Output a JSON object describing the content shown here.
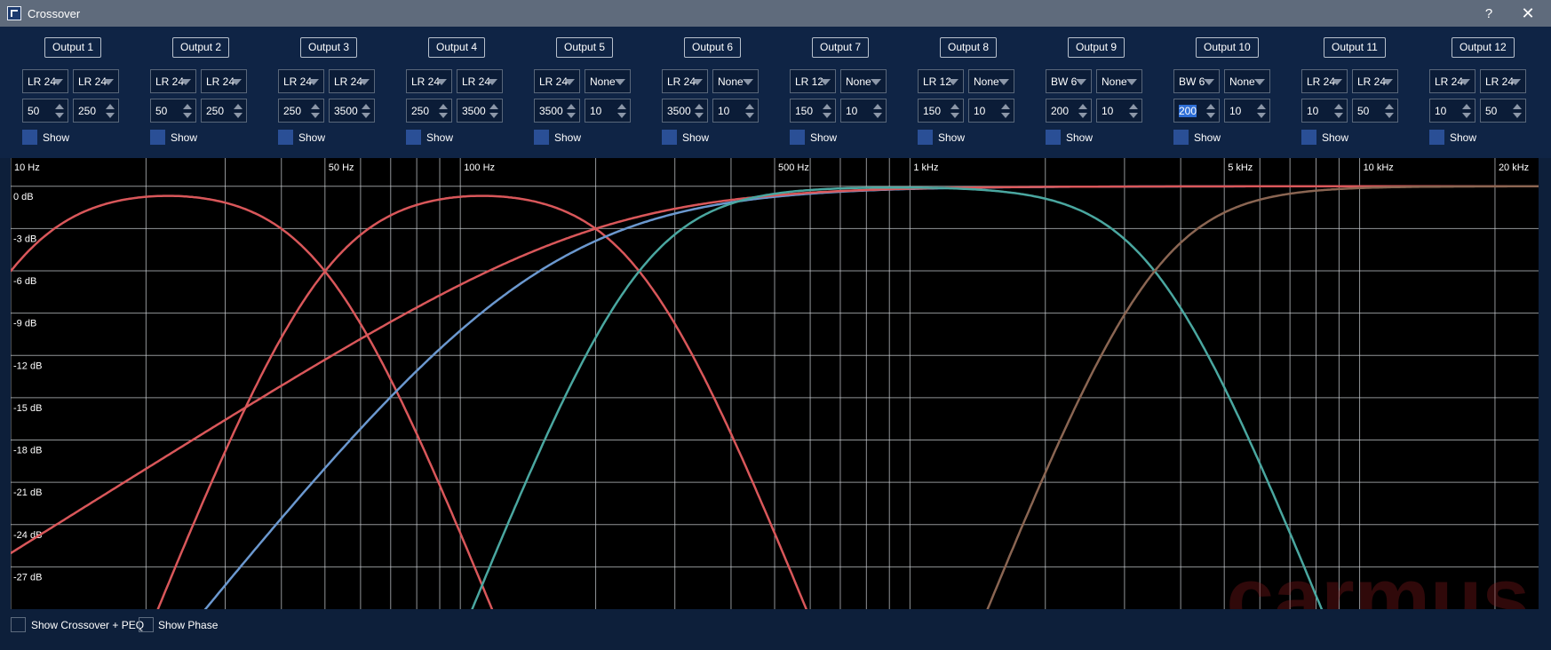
{
  "window": {
    "title": "Crossover",
    "help_label": "?",
    "close_label": "✕"
  },
  "colors": {
    "title_bar": "#5f6b7c",
    "panel": "#0f2445",
    "plot_bg": "#000000",
    "grid": "#cfd3d8",
    "curve_red": "#d9575a",
    "curve_blue": "#6b98cf",
    "curve_teal": "#4aa7a0",
    "curve_brown": "#8a6552",
    "checkbox": "#2a4f96"
  },
  "outputs": [
    {
      "label": "Output 1",
      "type_hp": "LR 24",
      "type_lp": "LR 24",
      "freq_hp": "50",
      "freq_lp": "250",
      "show": "Show"
    },
    {
      "label": "Output 2",
      "type_hp": "LR 24",
      "type_lp": "LR 24",
      "freq_hp": "50",
      "freq_lp": "250",
      "show": "Show"
    },
    {
      "label": "Output 3",
      "type_hp": "LR 24",
      "type_lp": "LR 24",
      "freq_hp": "250",
      "freq_lp": "3500",
      "show": "Show"
    },
    {
      "label": "Output 4",
      "type_hp": "LR 24",
      "type_lp": "LR 24",
      "freq_hp": "250",
      "freq_lp": "3500",
      "show": "Show"
    },
    {
      "label": "Output 5",
      "type_hp": "LR 24",
      "type_lp": "None",
      "freq_hp": "3500",
      "freq_lp": "10",
      "show": "Show"
    },
    {
      "label": "Output 6",
      "type_hp": "LR 24",
      "type_lp": "None",
      "freq_hp": "3500",
      "freq_lp": "10",
      "show": "Show"
    },
    {
      "label": "Output 7",
      "type_hp": "LR 12",
      "type_lp": "None",
      "freq_hp": "150",
      "freq_lp": "10",
      "show": "Show"
    },
    {
      "label": "Output 8",
      "type_hp": "LR 12",
      "type_lp": "None",
      "freq_hp": "150",
      "freq_lp": "10",
      "show": "Show"
    },
    {
      "label": "Output 9",
      "type_hp": "BW 6",
      "type_lp": "None",
      "freq_hp": "200",
      "freq_lp": "10",
      "show": "Show"
    },
    {
      "label": "Output 10",
      "type_hp": "BW 6",
      "type_lp": "None",
      "freq_hp": "200",
      "freq_lp": "10",
      "show": "Show",
      "selected_field": "freq_hp"
    },
    {
      "label": "Output 11",
      "type_hp": "LR 24",
      "type_lp": "LR 24",
      "freq_hp": "10",
      "freq_lp": "50",
      "show": "Show"
    },
    {
      "label": "Output 12",
      "type_hp": "LR 24",
      "type_lp": "LR 24",
      "freq_hp": "10",
      "freq_lp": "50",
      "show": "Show"
    }
  ],
  "graph": {
    "x_min": 10,
    "x_max": 25000,
    "y_min": -30,
    "y_max": 2,
    "scale": "log",
    "x_grid": [
      10,
      20,
      30,
      40,
      50,
      60,
      70,
      80,
      90,
      100,
      200,
      300,
      400,
      500,
      600,
      700,
      800,
      900,
      1000,
      2000,
      3000,
      4000,
      5000,
      6000,
      7000,
      8000,
      9000,
      10000,
      20000
    ],
    "x_labels": [
      {
        "label": "10 Hz",
        "f": 10
      },
      {
        "label": "50 Hz",
        "f": 50
      },
      {
        "label": "100 Hz",
        "f": 100
      },
      {
        "label": "500 Hz",
        "f": 500
      },
      {
        "label": "1 kHz",
        "f": 1000
      },
      {
        "label": "5 kHz",
        "f": 5000
      },
      {
        "label": "10 kHz",
        "f": 10000
      },
      {
        "label": "20 kHz",
        "f": 20000
      }
    ],
    "y_labels": [
      {
        "label": "0 dB",
        "v": 0
      },
      {
        "label": "-3 dB",
        "v": -3
      },
      {
        "label": "-6 dB",
        "v": -6
      },
      {
        "label": "-9 dB",
        "v": -9
      },
      {
        "label": "-12 dB",
        "v": -12
      },
      {
        "label": "-15 dB",
        "v": -15
      },
      {
        "label": "-18 dB",
        "v": -18
      },
      {
        "label": "-21 dB",
        "v": -21
      },
      {
        "label": "-24 dB",
        "v": -24
      },
      {
        "label": "-27 dB",
        "v": -27
      }
    ],
    "curves": [
      {
        "color": "#d9575a",
        "hp": {
          "type": "LR",
          "order": 4,
          "f": 10
        },
        "lp": {
          "type": "LR",
          "order": 4,
          "f": 50
        }
      },
      {
        "color": "#d9575a",
        "hp": {
          "type": "LR",
          "order": 4,
          "f": 50
        },
        "lp": {
          "type": "LR",
          "order": 4,
          "f": 250
        }
      },
      {
        "color": "#6b98cf",
        "hp": {
          "type": "LR",
          "order": 2,
          "f": 150
        }
      },
      {
        "color": "#d9575a",
        "hp": {
          "type": "BW",
          "order": 1,
          "f": 200
        }
      },
      {
        "color": "#4aa7a0",
        "hp": {
          "type": "LR",
          "order": 4,
          "f": 250
        },
        "lp": {
          "type": "LR",
          "order": 4,
          "f": 3500
        }
      },
      {
        "color": "#8a6552",
        "hp": {
          "type": "LR",
          "order": 4,
          "f": 3500
        }
      }
    ]
  },
  "footer": {
    "crossover_peq": "Show Crossover + PEQ",
    "phase": "Show Phase"
  },
  "watermark": "carmus"
}
